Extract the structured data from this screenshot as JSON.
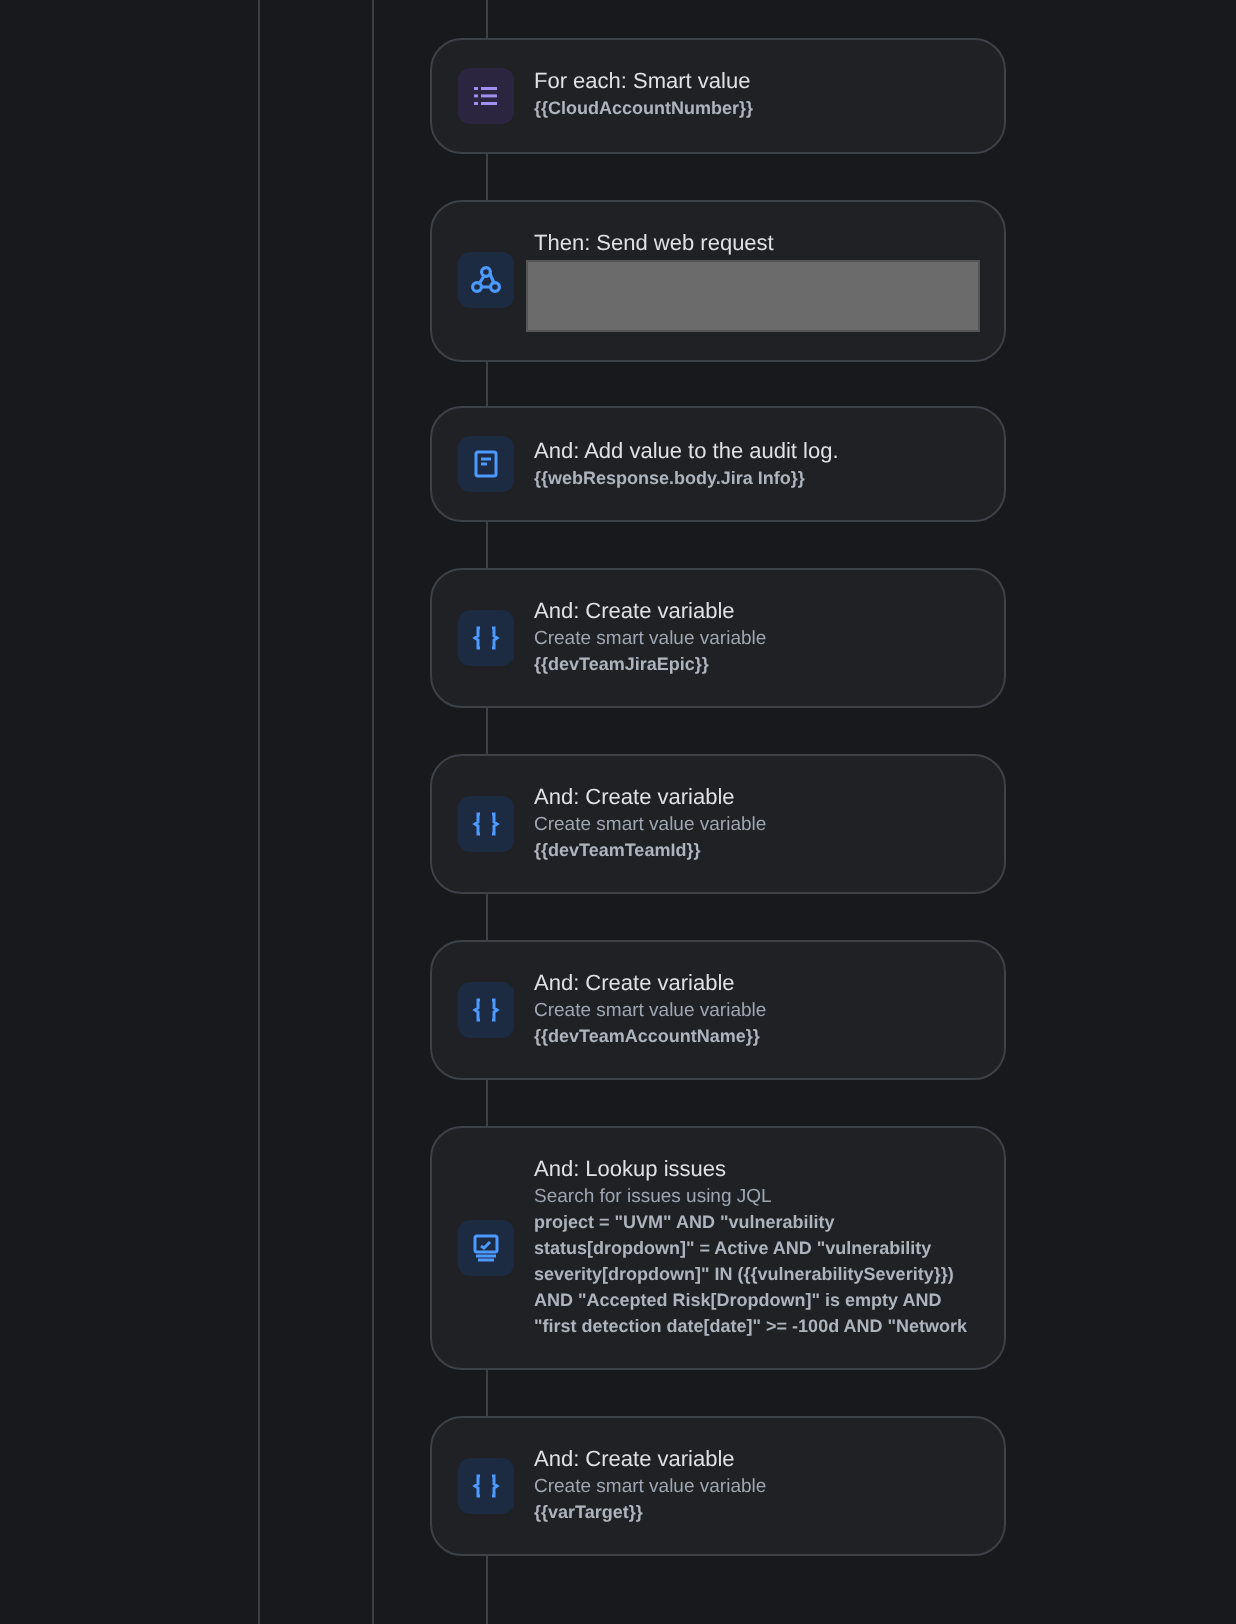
{
  "steps": [
    {
      "kind": "list",
      "title": "For each: Smart value",
      "value": "{{CloudAccountNumber}}"
    },
    {
      "kind": "webhook",
      "title": "Then: Send web request",
      "redacted": true
    },
    {
      "kind": "log",
      "title": "And: Add value to the audit log.",
      "value": "{{webResponse.body.Jira Info}}"
    },
    {
      "kind": "variable",
      "title": "And: Create variable",
      "subtitle": "Create smart value variable",
      "value": "{{devTeamJiraEpic}}"
    },
    {
      "kind": "variable",
      "title": "And: Create variable",
      "subtitle": "Create smart value variable",
      "value": "{{devTeamTeamId}}"
    },
    {
      "kind": "variable",
      "title": "And: Create variable",
      "subtitle": "Create smart value variable",
      "value": "{{devTeamAccountName}}"
    },
    {
      "kind": "lookup",
      "title": "And: Lookup issues",
      "subtitle": "Search for issues using JQL",
      "value": "project = \"UVM\" AND \"vulnerability status[dropdown]\" = Active AND \"vulnerability severity[dropdown]\" IN ({{vulnerabilitySeverity}}) AND \"Accepted Risk[Dropdown]\" is empty AND \"first detection date[date]\" >= -100d AND \"Network"
    },
    {
      "kind": "variable",
      "title": "And: Create variable",
      "subtitle": "Create smart value variable",
      "value": "{{varTarget}}"
    }
  ]
}
